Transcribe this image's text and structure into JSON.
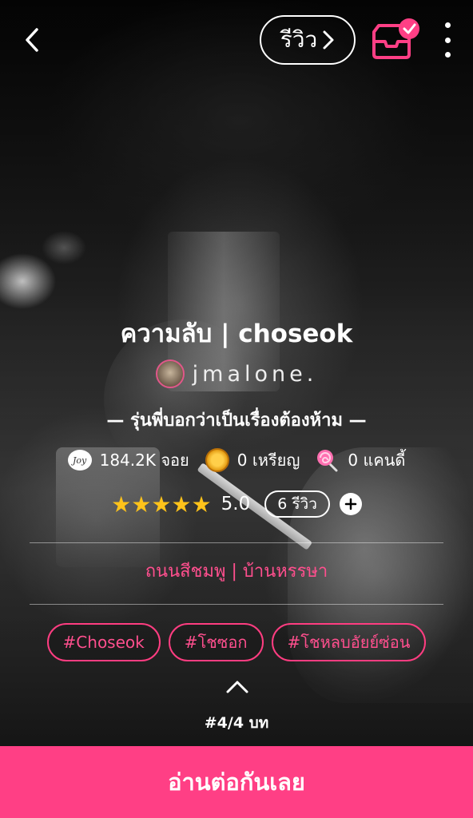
{
  "header": {
    "review_button": "รีวิว",
    "back_icon": "chevron-left-icon",
    "inbox_icon": "inbox-check-icon",
    "more_icon": "more-vertical-icon"
  },
  "story": {
    "title": "ความลับ | choseok",
    "author": "jmalone.",
    "synopsis": "— รุ่นพี่บอกว่าเป็นเรื่องต้องห้าม —",
    "stats": {
      "joy": "184.2K จอย",
      "joy_icon_text": "Joy",
      "coins": "0 เหรียญ",
      "candy": "0 แคนดี้"
    },
    "rating": {
      "stars": 5,
      "star_glyphs": "★★★★★",
      "value": "5.0",
      "reviews": "6 รีวิว"
    },
    "category": "ถนนสีชมพู | บ้านหรรษา",
    "tags": [
      "#Choseok",
      "#โชซอก",
      "#โชหลบอัยย์ซ่อน"
    ],
    "chapter": "#4/4 บท"
  },
  "cta": {
    "read_label": "อ่านต่อกันเลย"
  },
  "colors": {
    "accent": "#ff3f85",
    "star": "#ffc31a"
  }
}
